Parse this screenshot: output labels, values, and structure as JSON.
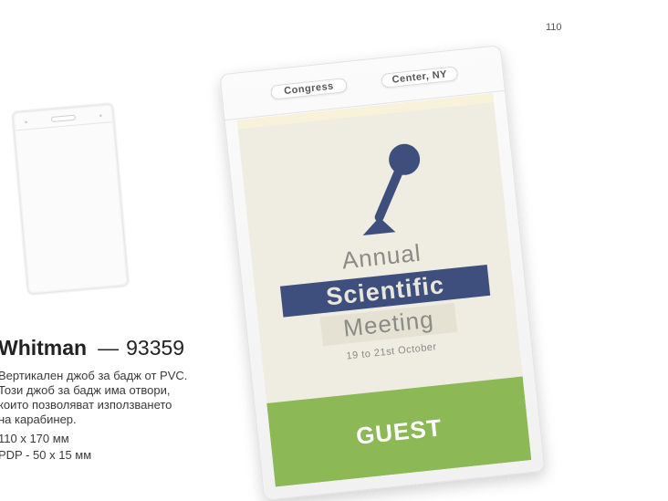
{
  "page": {
    "number": "110"
  },
  "product": {
    "name": "Whitman",
    "dash": "—",
    "code": "93359",
    "description_lines": [
      "Вертикален джоб за бадж от PVC.",
      "Този джоб за бадж има отвори,",
      "които позволяват използването",
      "на карабинер."
    ],
    "size": "110 x 170 мм",
    "pdp": "PDP - 50 x 15 мм"
  },
  "badge": {
    "slot_left": "Congress",
    "slot_right": "Center, NY",
    "line1": "Annual",
    "line2": "Scientific",
    "line3": "Meeting",
    "date": "19 to 21st October",
    "guest": "GUEST"
  },
  "colors": {
    "guest_bar": "#8db856",
    "ribbon_blue": "#3e4f7e",
    "insert_bg": "#efece2"
  },
  "icons": {
    "badge_icon": "microphone-icon"
  }
}
